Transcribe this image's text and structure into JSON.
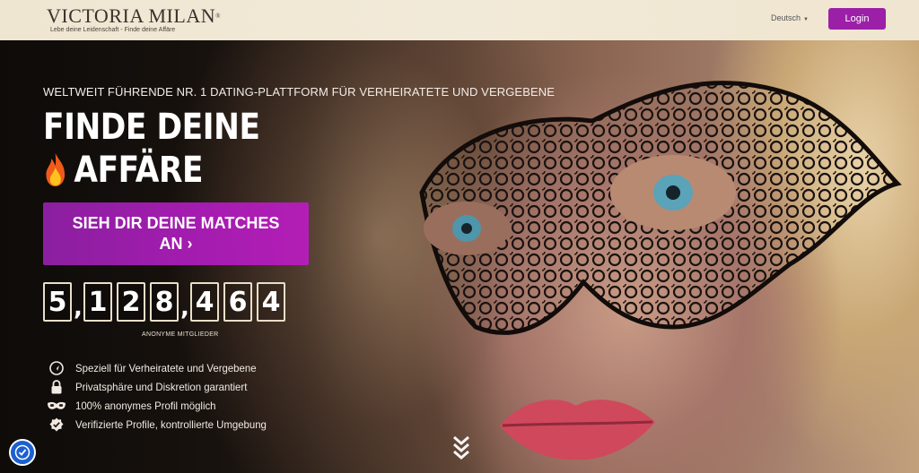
{
  "header": {
    "logo_text": "VICTORIA MILAN",
    "logo_reg": "®",
    "logo_tagline": "Lebe deine Leidenschaft - Finde deine Affäre",
    "language": "Deutsch",
    "login_label": "Login"
  },
  "hero": {
    "tagline": "WELTWEIT FÜHRENDE NR. 1 DATING-PLATTFORM FÜR VERHEIRATETE UND VERGEBENE",
    "headline_line1": "FINDE DEINE",
    "headline_line2": "AFFÄRE",
    "cta_label": "SIEH DIR DEINE MATCHES AN ›",
    "counter": {
      "digits": [
        "5",
        ",",
        "1",
        "2",
        "8",
        ",",
        "4",
        "6",
        "4"
      ],
      "label": "ANONYME MITGLIEDER"
    },
    "features": [
      {
        "icon": "location-pin-icon",
        "text": "Speziell für Verheiratete und Vergebene"
      },
      {
        "icon": "lock-icon",
        "text": "Privatsphäre und Diskretion garantiert"
      },
      {
        "icon": "mask-icon",
        "text": "100% anonymes Profil möglich"
      },
      {
        "icon": "verified-badge-icon",
        "text": "Verifizierte Profile, kontrollierte Umgebung"
      }
    ]
  },
  "colors": {
    "accent": "#9c1fa8",
    "header_bg": "#f0e7d4",
    "a11y_button": "#1c5fd0"
  }
}
